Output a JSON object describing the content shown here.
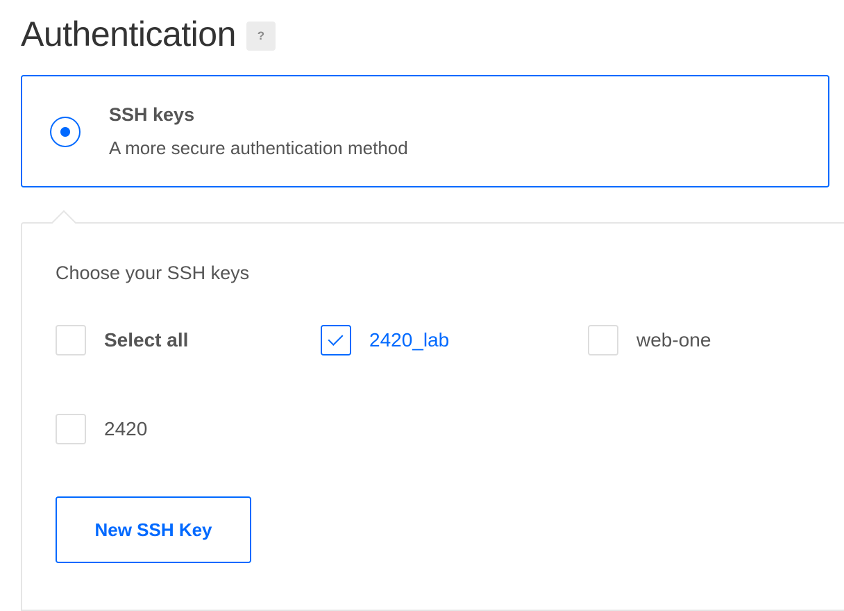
{
  "header": {
    "title": "Authentication",
    "help_icon": "?"
  },
  "method": {
    "title": "SSH keys",
    "description": "A more secure authentication method",
    "selected": true
  },
  "keys_panel": {
    "label": "Choose your SSH keys",
    "select_all_label": "Select all",
    "keys": [
      {
        "label": "2420_lab",
        "checked": true
      },
      {
        "label": "web-one",
        "checked": false
      },
      {
        "label": "2420",
        "checked": false
      }
    ],
    "new_key_button": "New SSH Key"
  },
  "colors": {
    "accent": "#0069ff",
    "text": "#555555",
    "border": "#dddddd"
  }
}
